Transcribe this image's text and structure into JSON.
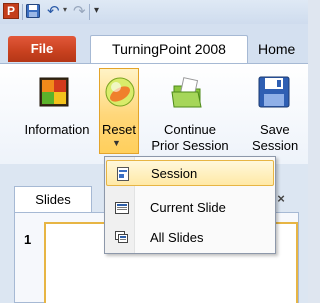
{
  "app": {
    "icon_letter": "P",
    "qat": {
      "save_icon": "save-icon",
      "undo_icon": "undo-icon",
      "redo_icon": "redo-icon",
      "customize_icon": "customize-icon"
    }
  },
  "tabs": {
    "file": "File",
    "active": "TurningPoint 2008",
    "next": "Home"
  },
  "ribbon": {
    "information": "Information",
    "reset": "Reset",
    "continue_line1": "Continue",
    "continue_line2": "Prior Session",
    "save_line1": "Save",
    "save_line2": "Session"
  },
  "reset_menu": {
    "items": [
      {
        "label": "Session",
        "icon": "session-icon",
        "highlighted": true
      },
      {
        "label": "Current Slide",
        "icon": "current-slide-icon",
        "highlighted": false
      },
      {
        "label": "All Slides",
        "icon": "all-slides-icon",
        "highlighted": false
      }
    ]
  },
  "slides_pane": {
    "tab": "Slides",
    "close": "×",
    "slide_number": "1"
  },
  "colors": {
    "file_tab": "#c8411f",
    "highlight_border": "#e7b544",
    "highlight_fill": "#ffe9a6"
  }
}
